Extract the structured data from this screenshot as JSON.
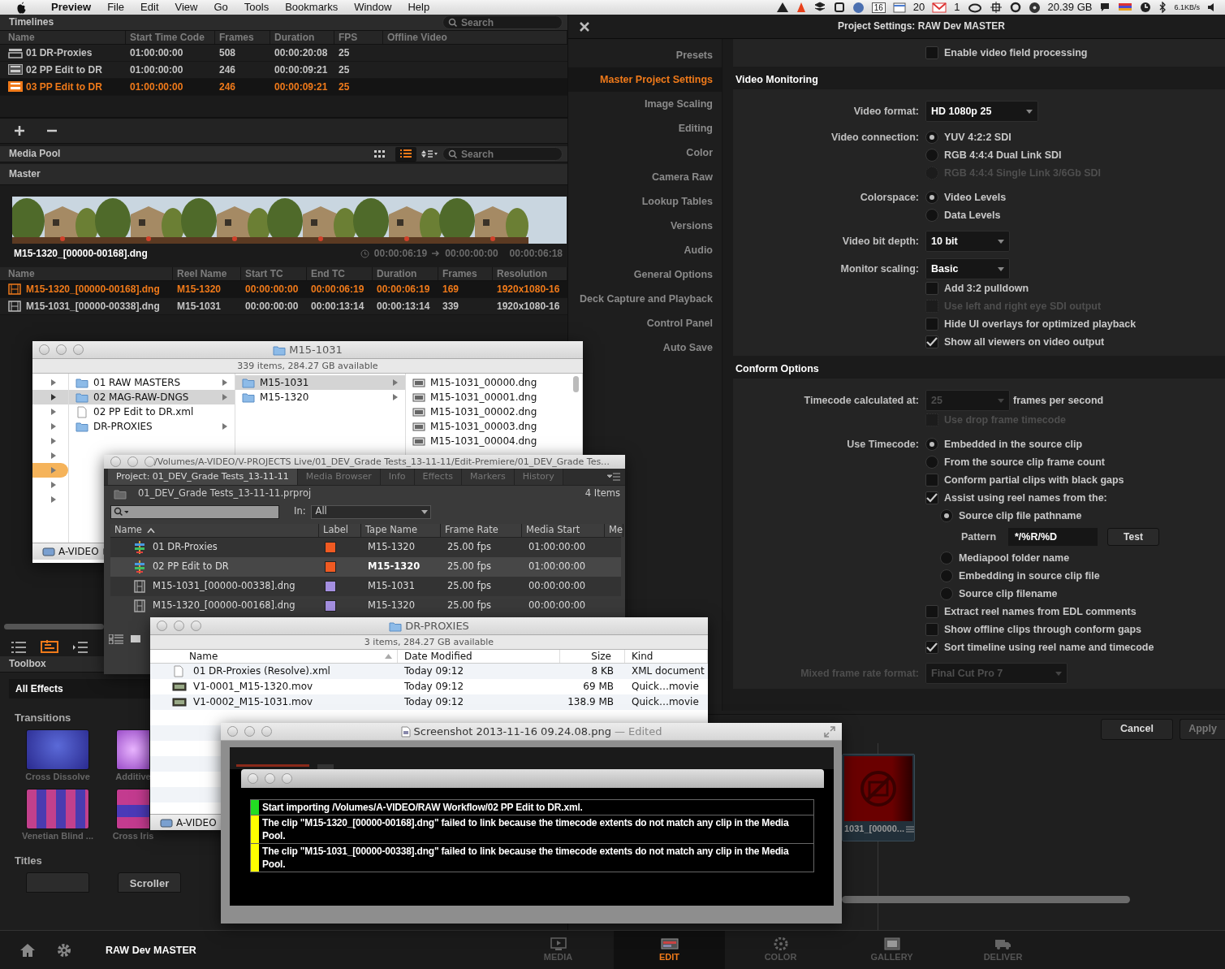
{
  "menubar": {
    "app": "Preview",
    "menus": [
      "File",
      "Edit",
      "View",
      "Go",
      "Tools",
      "Bookmarks",
      "Window",
      "Help"
    ],
    "status": [
      "16",
      "20",
      "1",
      "20.39 GB",
      "6.1KB/s"
    ]
  },
  "timelines": {
    "title": "Timelines",
    "search_placeholder": "Search",
    "columns": [
      "Name",
      "Start Time Code",
      "Frames",
      "Duration",
      "FPS",
      "Offline Video"
    ],
    "rows": [
      {
        "kind": "bin",
        "selected": false,
        "cells": [
          "01 DR-Proxies",
          "01:00:00:00",
          "508",
          "00:00:20:08",
          "25"
        ]
      },
      {
        "kind": "xml",
        "selected": false,
        "cells": [
          "02 PP Edit to DR",
          "01:00:00:00",
          "246",
          "00:00:09:21",
          "25"
        ]
      },
      {
        "kind": "xml",
        "selected": true,
        "cells": [
          "03 PP Edit to DR",
          "01:00:00:00",
          "246",
          "00:00:09:21",
          "25"
        ]
      }
    ]
  },
  "media_pool": {
    "title": "Media Pool",
    "search_placeholder": "Search",
    "view_modes": [
      {
        "selected": false
      },
      {
        "selected": true
      }
    ],
    "bin": "Master",
    "clip_name": "M15-1320_[00000-00168].dng",
    "timecodes": [
      "00:00:06:19",
      "00:00:00:00",
      "00:00:06:18"
    ],
    "columns": [
      "Name",
      "Reel Name",
      "Start TC",
      "End TC",
      "Duration",
      "Frames",
      "Resolution"
    ],
    "rows": [
      {
        "selected": true,
        "cells": [
          "M15-1320_[00000-00168].dng",
          "M15-1320",
          "00:00:00:00",
          "00:00:06:19",
          "00:00:06:19",
          "169",
          "1920x1080-16"
        ]
      },
      {
        "selected": false,
        "cells": [
          "M15-1031_[00000-00338].dng",
          "M15-1031",
          "00:00:00:00",
          "00:00:13:14",
          "00:00:13:14",
          "339",
          "1920x1080-16"
        ]
      }
    ]
  },
  "toolbox": {
    "title": "Toolbox",
    "filter": "All Effects",
    "transitions_title": "Transitions",
    "transitions": [
      {
        "kind": "dissolve",
        "label": "Cross Dissolve"
      },
      {
        "kind": "additive",
        "label": "Additive"
      },
      {
        "kind": "blind",
        "label": "Venetian Blind ..."
      },
      {
        "kind": "iris",
        "label": "Cross Iris"
      }
    ],
    "titles_title": "Titles",
    "titles": [
      "Scroller"
    ]
  },
  "settings": {
    "title": "Project Settings:  RAW Dev MASTER",
    "nav": [
      {
        "label": "Presets",
        "selected": false
      },
      {
        "label": "Master Project Settings",
        "selected": true
      },
      {
        "label": "Image Scaling",
        "selected": false
      },
      {
        "label": "Editing",
        "selected": false
      },
      {
        "label": "Color",
        "selected": false
      },
      {
        "label": "Camera Raw",
        "selected": false
      },
      {
        "label": "Lookup Tables",
        "selected": false
      },
      {
        "label": "Versions",
        "selected": false
      },
      {
        "label": "Audio",
        "selected": false
      },
      {
        "label": "General Options",
        "selected": false
      },
      {
        "label": "Deck Capture and Playback",
        "selected": false
      },
      {
        "label": "Control Panel",
        "selected": false
      },
      {
        "label": "Auto Save",
        "selected": false
      }
    ],
    "sections": [
      {
        "rows": [
          {
            "kind": "check",
            "text": "Enable video field processing",
            "checked": false,
            "disabled": false
          }
        ]
      },
      {
        "title": "Video Monitoring",
        "rows": [
          {
            "kind": "select",
            "label": "Video format:",
            "value": "HD 1080p 25",
            "disabled": false,
            "label_disabled": false
          },
          {
            "kind": "radio",
            "label": "Video connection:",
            "options": [
              {
                "text": "YUV 4:2:2 SDI",
                "selected": true,
                "disabled": false
              },
              {
                "text": "RGB 4:4:4 Dual Link SDI",
                "selected": false,
                "disabled": false
              },
              {
                "text": "RGB 4:4:4 Single Link 3/6Gb SDI",
                "selected": false,
                "disabled": true
              }
            ]
          },
          {
            "kind": "radio",
            "label": "Colorspace:",
            "options": [
              {
                "text": "Video Levels",
                "selected": true,
                "disabled": false
              },
              {
                "text": "Data Levels",
                "selected": false,
                "disabled": false
              }
            ]
          },
          {
            "kind": "select",
            "label": "Video bit depth:",
            "value": "10 bit",
            "disabled": false,
            "label_disabled": false
          },
          {
            "kind": "select",
            "label": "Monitor scaling:",
            "value": "Basic",
            "disabled": false,
            "label_disabled": false
          },
          {
            "kind": "check",
            "text": "Add 3:2 pulldown",
            "checked": false,
            "disabled": false
          },
          {
            "kind": "check",
            "text": "Use left and right eye SDI output",
            "checked": false,
            "disabled": true
          },
          {
            "kind": "check",
            "text": "Hide UI overlays for optimized playback",
            "checked": false,
            "disabled": false
          },
          {
            "kind": "check",
            "text": "Show all viewers on video output",
            "checked": true,
            "disabled": false
          }
        ]
      },
      {
        "title": "Conform Options",
        "rows": [
          {
            "kind": "select",
            "label": "Timecode calculated at:",
            "value": "25",
            "suffix": "frames per second",
            "disabled": true,
            "label_disabled": false
          },
          {
            "kind": "check",
            "text": "Use drop frame timecode",
            "checked": false,
            "disabled": true
          },
          {
            "kind": "radio",
            "label": "Use Timecode:",
            "options": [
              {
                "text": "Embedded in the source clip",
                "selected": true,
                "disabled": false
              },
              {
                "text": "From the source clip frame count",
                "selected": false,
                "disabled": false
              }
            ]
          },
          {
            "kind": "check",
            "text": "Conform partial clips with black gaps",
            "checked": false,
            "disabled": false
          },
          {
            "kind": "check",
            "text": "Assist using reel names from the:",
            "checked": true,
            "disabled": false
          },
          {
            "kind": "subradio",
            "text": "Source clip file pathname",
            "selected": true
          },
          {
            "kind": "pattern",
            "label": "Pattern",
            "value": "*/%R/%D",
            "button": "Test"
          },
          {
            "kind": "subradio",
            "text": "Mediapool folder name",
            "selected": false
          },
          {
            "kind": "subradio",
            "text": "Embedding in source clip file",
            "selected": false
          },
          {
            "kind": "subradio",
            "text": "Source clip filename",
            "selected": false
          },
          {
            "kind": "check",
            "text": "Extract reel names from EDL comments",
            "checked": false,
            "disabled": false
          },
          {
            "kind": "check",
            "text": "Show offline clips through conform gaps",
            "checked": false,
            "disabled": false
          },
          {
            "kind": "check",
            "text": "Sort timeline using reel name and timecode",
            "checked": true,
            "disabled": false
          },
          {
            "kind": "select",
            "label": "Mixed frame rate format:",
            "value": "Final Cut Pro 7",
            "disabled": true,
            "label_disabled": true
          }
        ]
      }
    ],
    "buttons": [
      "Cancel",
      "Apply"
    ]
  },
  "timeline_clip": "1031_[00000...",
  "bottom_bar": {
    "project": "RAW Dev MASTER",
    "pages": [
      {
        "label": "MEDIA",
        "selected": false
      },
      {
        "label": "EDIT",
        "selected": true
      },
      {
        "label": "COLOR",
        "selected": false
      },
      {
        "label": "GALLERY",
        "selected": false
      },
      {
        "label": "DELIVER",
        "selected": false
      }
    ]
  },
  "finder_raw": {
    "title": "M15-1031",
    "status": "339 items, 284.27 GB available",
    "sidebar_rows": [
      {
        "selected": false,
        "focused": false
      },
      {
        "selected": true,
        "focused": false
      },
      {
        "selected": false,
        "focused": false
      },
      {
        "selected": false,
        "focused": false
      },
      {
        "selected": false,
        "focused": false
      },
      {
        "selected": false,
        "focused": false
      },
      {
        "selected": false,
        "focused": true
      },
      {
        "selected": false,
        "focused": false
      },
      {
        "selected": false,
        "focused": false
      }
    ],
    "column_2": [
      {
        "kind": "folder",
        "name": "01 RAW MASTERS",
        "selected": false
      },
      {
        "kind": "folder",
        "name": "02 MAG-RAW-DNGS",
        "selected": true
      },
      {
        "kind": "file",
        "name": "02 PP Edit to DR.xml",
        "selected": false
      },
      {
        "kind": "folder",
        "name": "DR-PROXIES",
        "selected": false
      }
    ],
    "column_3": [
      {
        "kind": "folder",
        "name": "M15-1031",
        "selected": true
      },
      {
        "kind": "folder",
        "name": "M15-1320",
        "selected": false
      }
    ],
    "column_4": [
      "M15-1031_00000.dng",
      "M15-1031_00001.dng",
      "M15-1031_00002.dng",
      "M15-1031_00003.dng",
      "M15-1031_00004.dng"
    ],
    "path": "A-VIDEO"
  },
  "premiere": {
    "title": "/Volumes/A-VIDEO/V-PROJECTS Live/01_DEV_Grade Tests_13-11-11/Edit-Premiere/01_DEV_Grade Tes…",
    "tabs": [
      {
        "label": "Project: 01_DEV_Grade Tests_13-11-11",
        "selected": true
      },
      {
        "label": "Media Browser",
        "selected": false
      },
      {
        "label": "Info",
        "selected": false
      },
      {
        "label": "Effects",
        "selected": false
      },
      {
        "label": "Markers",
        "selected": false
      },
      {
        "label": "History",
        "selected": false
      }
    ],
    "project_file": "01_DEV_Grade Tests_13-11-11.prproj",
    "item_count": "4 Items",
    "in_label": "In:",
    "in_value": "All",
    "columns": [
      "Name",
      "Label",
      "Tape Name",
      "Frame Rate",
      "Media Start",
      "Me"
    ],
    "rows": [
      {
        "kind": "sequence",
        "color": "#f05a22",
        "selected": false,
        "cells": [
          "01 DR-Proxies",
          "",
          "M15-1320",
          "25.00 fps",
          "01:00:00:00"
        ]
      },
      {
        "kind": "sequence",
        "color": "#f05a22",
        "selected": true,
        "cells": [
          "02 PP Edit to DR",
          "",
          "M15-1320",
          "25.00 fps",
          "01:00:00:00"
        ]
      },
      {
        "kind": "clip",
        "color": "#a48fe0",
        "selected": false,
        "cells": [
          "M15-1031_[00000-00338].dng",
          "",
          "M15-1031",
          "25.00 fps",
          "00:00:00:00"
        ]
      },
      {
        "kind": "clip",
        "color": "#a48fe0",
        "selected": false,
        "cells": [
          "M15-1320_[00000-00168].dng",
          "",
          "M15-1320",
          "25.00 fps",
          "00:00:00:00"
        ]
      }
    ]
  },
  "finder_proxies": {
    "title": "DR-PROXIES",
    "status": "3 items, 284.27 GB available",
    "columns": [
      "Name",
      "Date Modified",
      "Size",
      "Kind"
    ],
    "rows": [
      {
        "kind": "xml",
        "cells": [
          "01 DR-Proxies (Resolve).xml",
          "Today 09:12",
          "8 KB",
          "XML document"
        ]
      },
      {
        "kind": "movie",
        "cells": [
          "V1-0001_M15-1320.mov",
          "Today 09:12",
          "69 MB",
          "Quick…movie"
        ]
      },
      {
        "kind": "movie",
        "cells": [
          "V1-0002_M15-1031.mov",
          "Today 09:12",
          "138.9 MB",
          "Quick…movie"
        ]
      }
    ],
    "path": "A-VIDEO"
  },
  "preview": {
    "title": "Screenshot 2013-11-16 09.24.08.png",
    "edited": "— Edited",
    "log": [
      {
        "color": "#22dd22",
        "text": "Start importing /Volumes/A-VIDEO/RAW Workflow/02 PP Edit to DR.xml."
      },
      {
        "color": "#ffff00",
        "text": "The clip \"M15-1320_[00000-00168].dng\" failed to link because the timecode extents do not match any clip in the Media Pool."
      },
      {
        "color": "#ffff00",
        "text": "The clip \"M15-1031_[00000-00338].dng\" failed to link because the timecode extents do not match any clip in the Media Pool."
      }
    ]
  }
}
